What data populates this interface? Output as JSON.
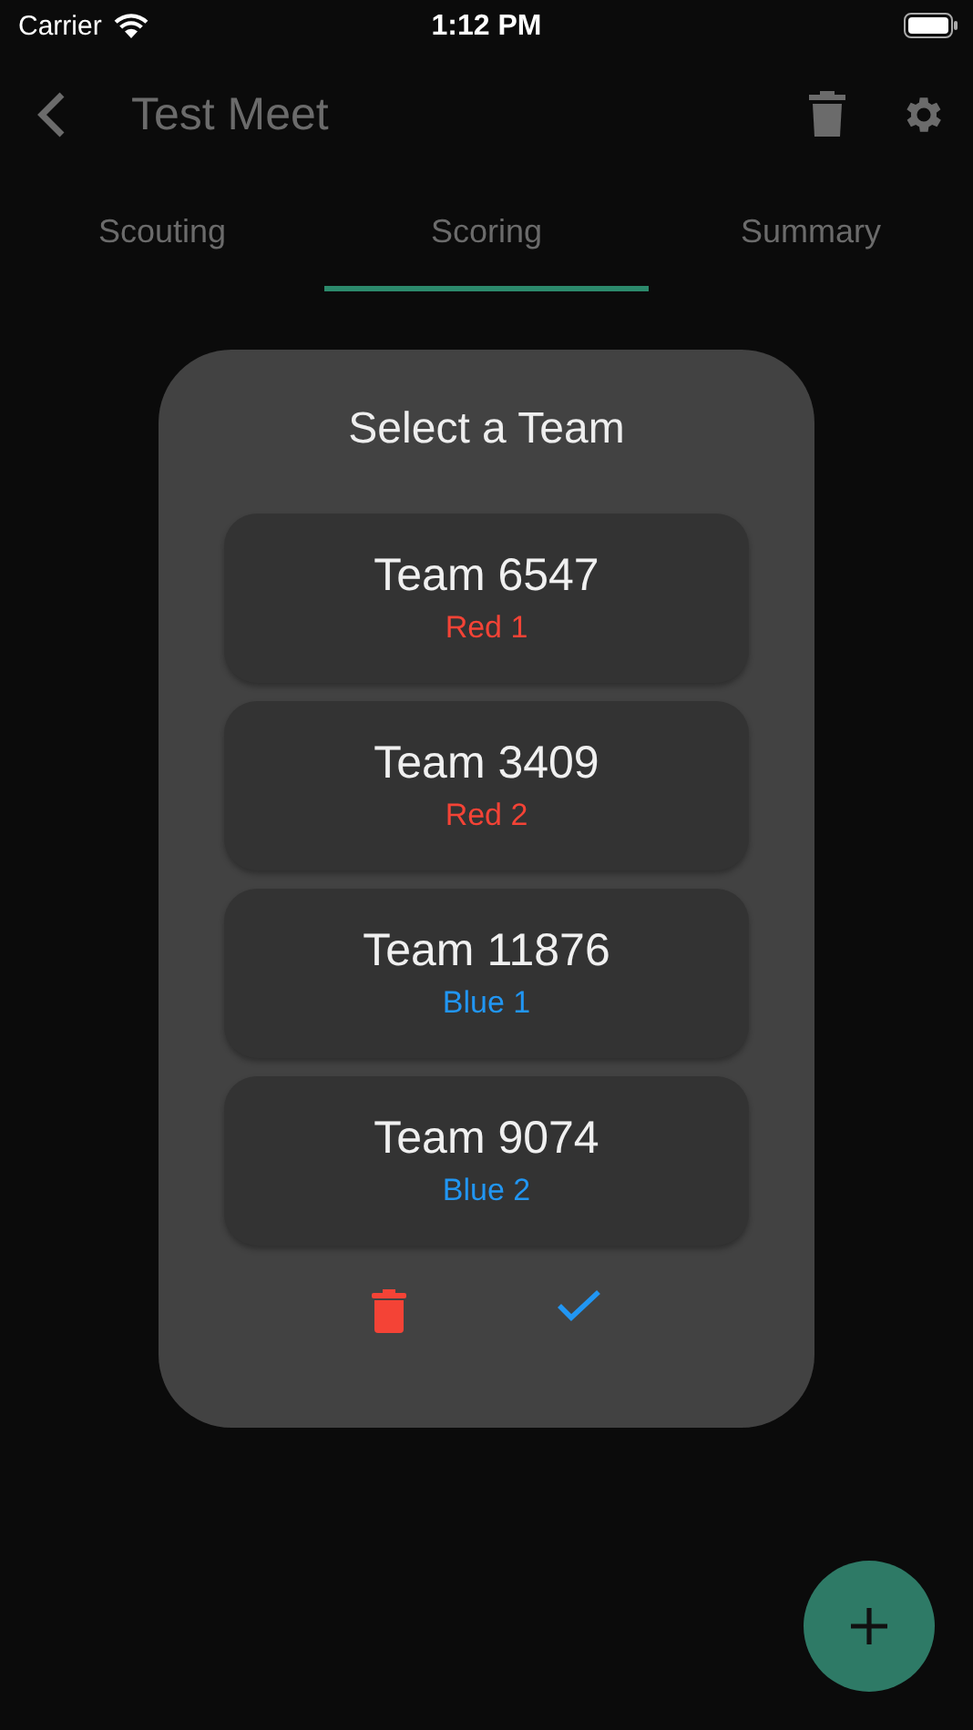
{
  "status_bar": {
    "carrier": "Carrier",
    "time": "1:12 PM"
  },
  "app_bar": {
    "title": "Test Meet"
  },
  "tabs": [
    {
      "label": "Scouting",
      "selected": false
    },
    {
      "label": "Scoring",
      "selected": true
    },
    {
      "label": "Summary",
      "selected": false
    }
  ],
  "dialog": {
    "title": "Select a Team",
    "teams": [
      {
        "name": "Team 6547",
        "position": "Red 1",
        "color": "#f44336"
      },
      {
        "name": "Team 3409",
        "position": "Red 2",
        "color": "#f44336"
      },
      {
        "name": "Team 11876",
        "position": "Blue 1",
        "color": "#2196f3"
      },
      {
        "name": "Team 9074",
        "position": "Blue 2",
        "color": "#2196f3"
      }
    ]
  }
}
